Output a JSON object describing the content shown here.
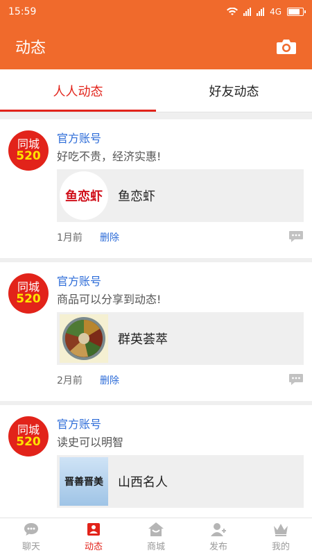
{
  "status_bar": {
    "time": "15:59",
    "network": "4G"
  },
  "header": {
    "title": "动态",
    "camera_icon": "camera-icon"
  },
  "tabs": [
    {
      "label": "人人动态",
      "active": true
    },
    {
      "label": "好友动态",
      "active": false
    }
  ],
  "posts": [
    {
      "avatar_text": [
        "同城",
        "520"
      ],
      "author": "官方账号",
      "text": "好吃不贵，经济实惠!",
      "share": {
        "title": "鱼恋虾",
        "thumb_text": "鱼恋虾"
      },
      "time": "1月前",
      "delete_label": "删除"
    },
    {
      "avatar_text": [
        "同城",
        "520"
      ],
      "author": "官方账号",
      "text": "商品可以分享到动态!",
      "share": {
        "title": "群英荟萃"
      },
      "time": "2月前",
      "delete_label": "删除"
    },
    {
      "avatar_text": [
        "同城",
        "520"
      ],
      "author": "官方账号",
      "text": "读史可以明智",
      "share": {
        "title": "山西名人",
        "thumb_text": "晋善晋美"
      }
    }
  ],
  "bottom_nav": [
    {
      "label": "聊天",
      "icon": "chat-icon",
      "active": false
    },
    {
      "label": "动态",
      "icon": "feed-icon",
      "active": true
    },
    {
      "label": "商城",
      "icon": "shop-icon",
      "active": false
    },
    {
      "label": "发布",
      "icon": "user-add-icon",
      "active": false
    },
    {
      "label": "我的",
      "icon": "crown-icon",
      "active": false
    }
  ],
  "colors": {
    "brand": "#f06a2c",
    "accent": "#e2231a",
    "link": "#2d6cd8"
  }
}
